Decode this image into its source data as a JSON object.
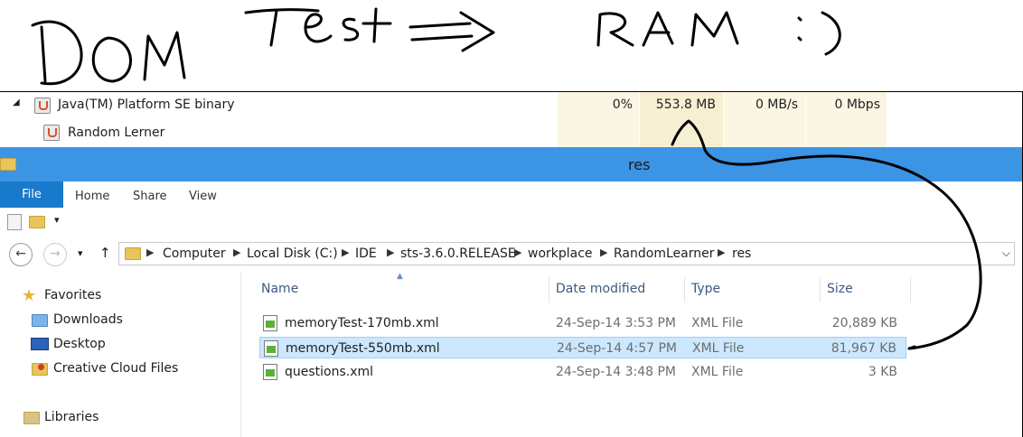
{
  "annotation": {
    "text_left": "DOM Test",
    "text_right": "RAM :)"
  },
  "task_manager": {
    "process_name": "Java(TM) Platform SE binary",
    "child_name": "Random Lerner",
    "cpu": "0%",
    "memory": "553.8 MB",
    "disk": "0 MB/s",
    "network": "0 Mbps"
  },
  "explorer": {
    "window_title": "res",
    "ribbon_tabs": [
      "File",
      "Home",
      "Share",
      "View"
    ],
    "qat_dropdown": "▾",
    "nav": {
      "back": "←",
      "forward": "→",
      "recent": "▾",
      "up": "↑"
    },
    "breadcrumb": [
      "Computer",
      "Local Disk (C:)",
      "IDE",
      "sts-3.6.0.RELEASE",
      "workplace",
      "RandomLearner",
      "res"
    ],
    "sidebar": [
      {
        "label": "Favorites",
        "icon": "star-icon"
      },
      {
        "label": "Downloads",
        "icon": "downloads-folder-icon"
      },
      {
        "label": "Desktop",
        "icon": "desktop-icon"
      },
      {
        "label": "Creative Cloud Files",
        "icon": "creative-cloud-icon"
      },
      {
        "label": "Libraries",
        "icon": "libraries-icon"
      }
    ],
    "columns": [
      "Name",
      "Date modified",
      "Type",
      "Size"
    ],
    "files": [
      {
        "name": "memoryTest-170mb.xml",
        "date": "24-Sep-14 3:53 PM",
        "type": "XML File",
        "size": "20,889 KB",
        "selected": false
      },
      {
        "name": "memoryTest-550mb.xml",
        "date": "24-Sep-14 4:57 PM",
        "type": "XML File",
        "size": "81,967 KB",
        "selected": true
      },
      {
        "name": "questions.xml",
        "date": "24-Sep-14 3:48 PM",
        "type": "XML File",
        "size": "3 KB",
        "selected": false
      }
    ]
  }
}
